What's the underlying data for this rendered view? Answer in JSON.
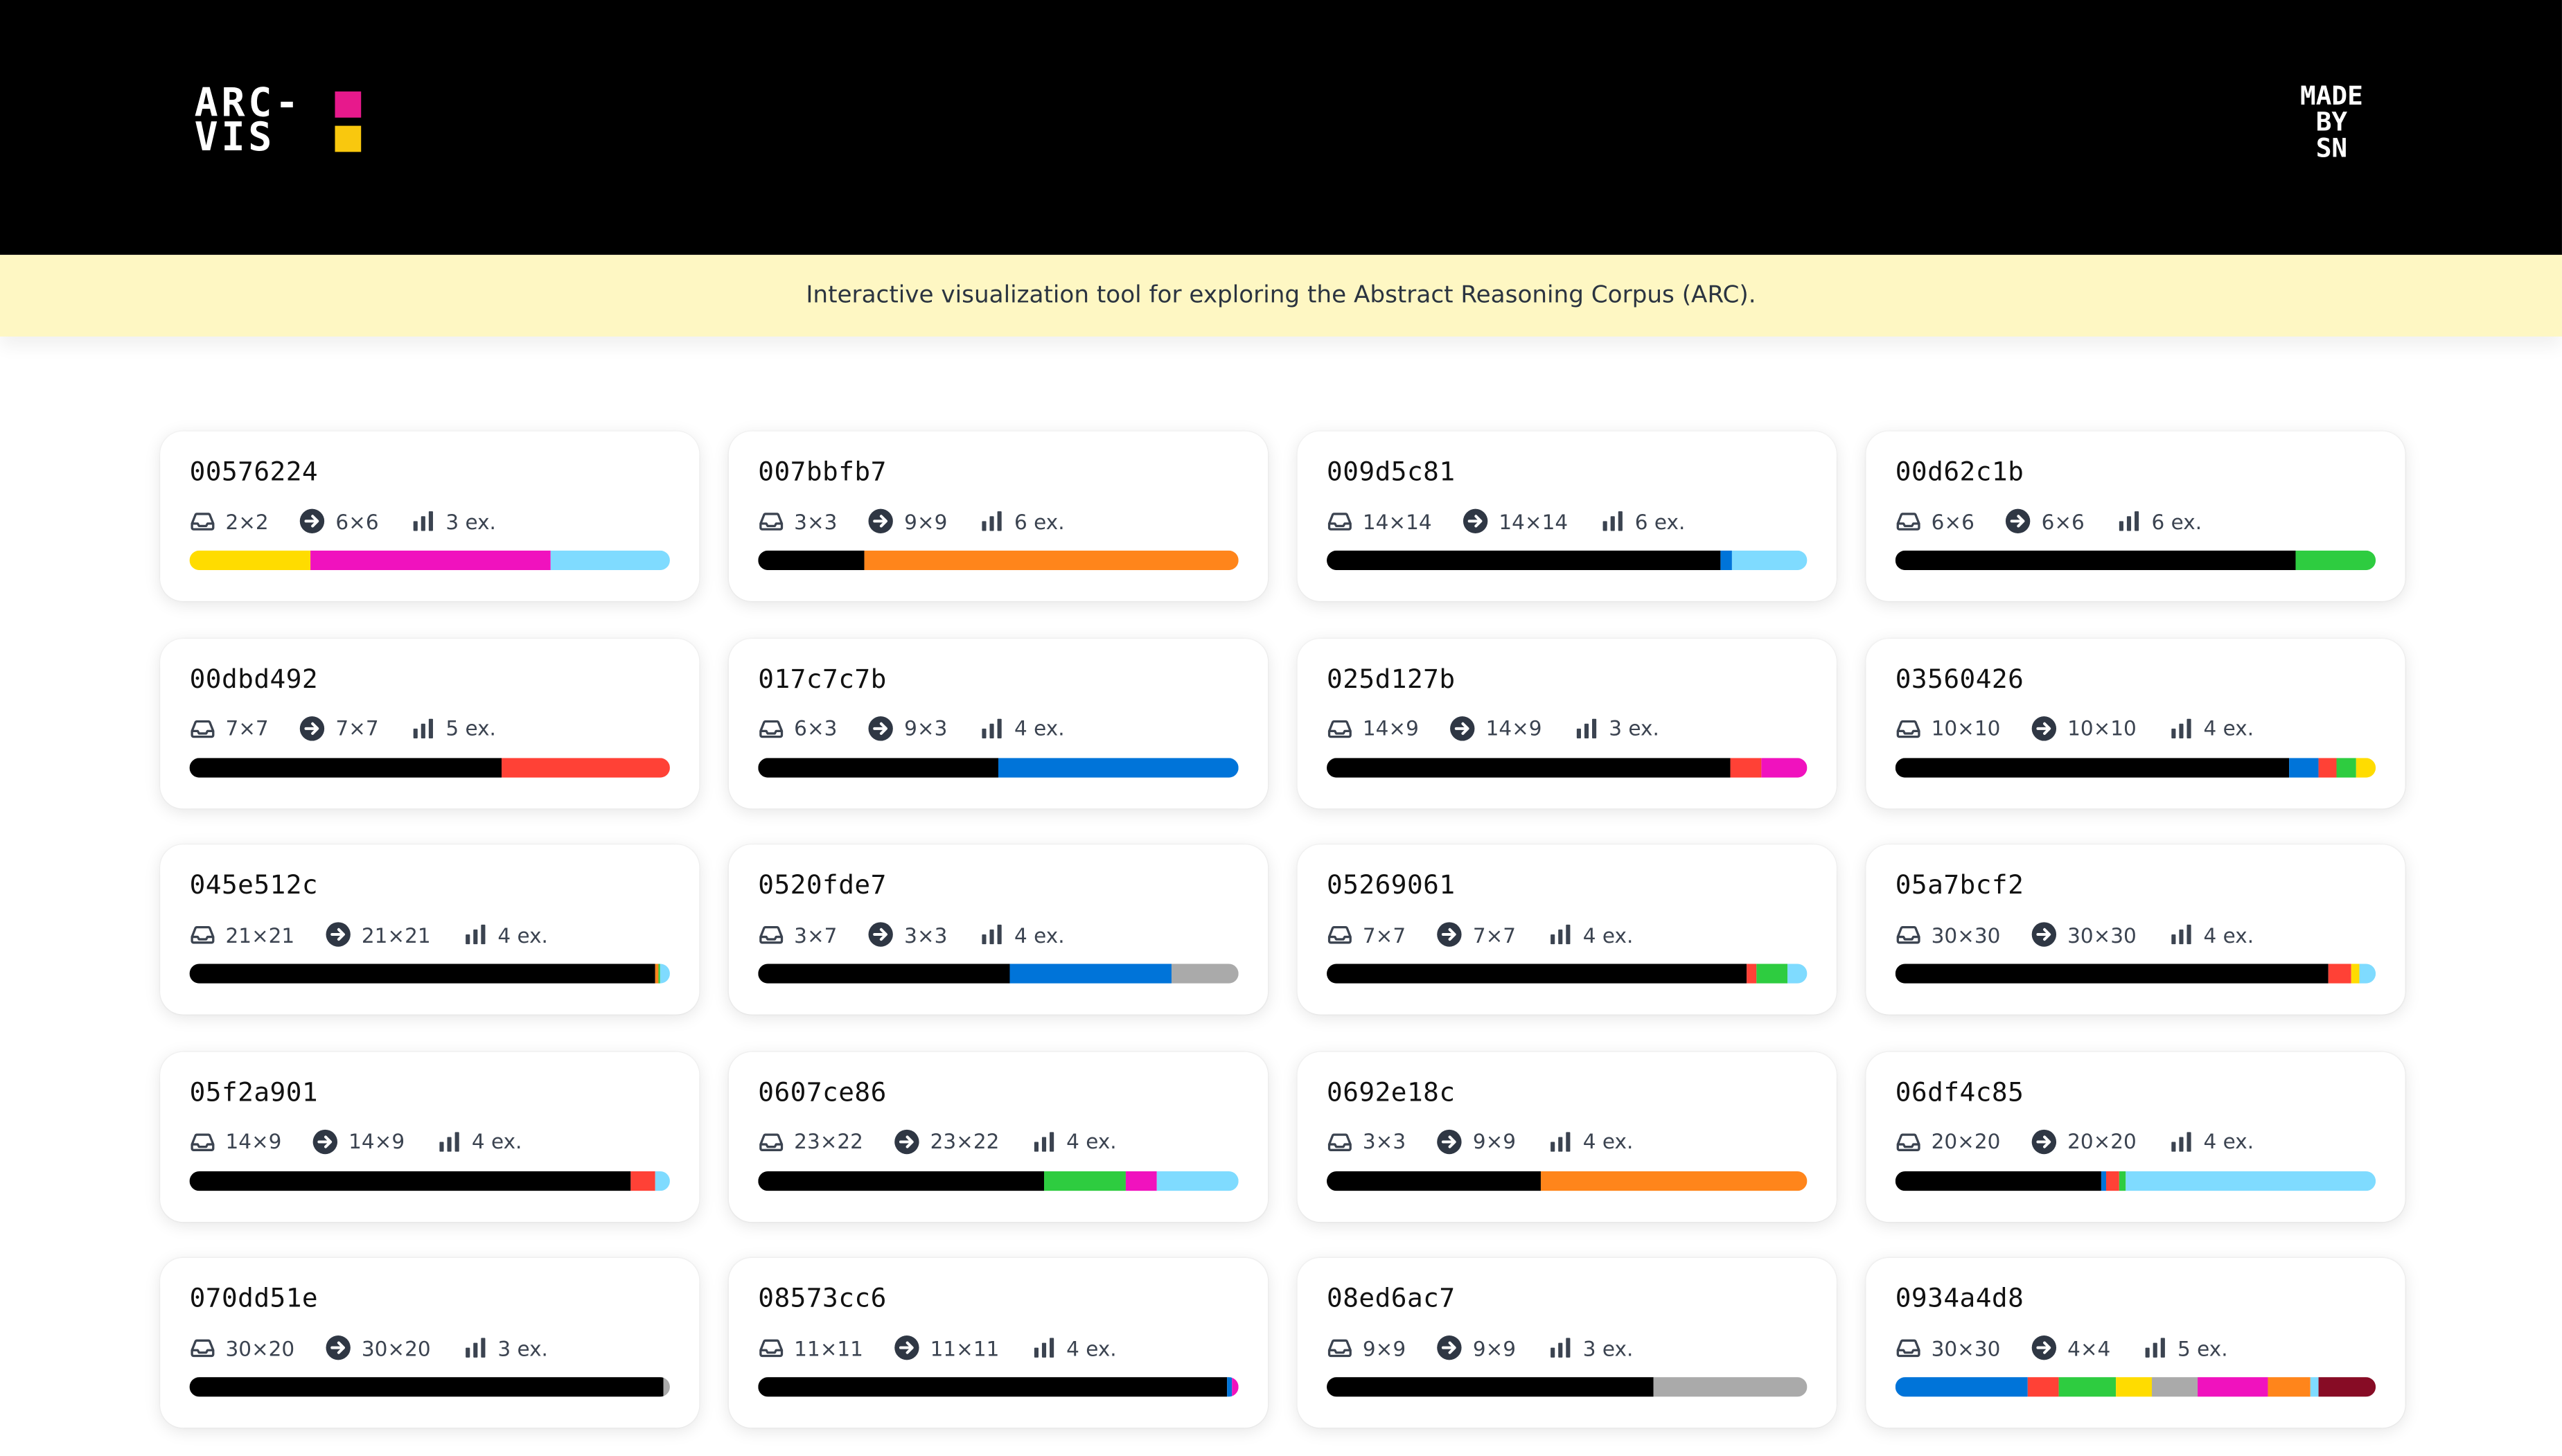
{
  "header": {
    "logo_line1": "ARC-",
    "logo_line2": "VIS",
    "logo_colors": [
      "#e7198c",
      "#f9c80e"
    ],
    "maker": [
      "MADE",
      "BY",
      "SN"
    ]
  },
  "banner": {
    "text": "Interactive visualization tool for exploring the Abstract Reasoning Corpus (ARC)."
  },
  "icons": {
    "input": "tray-icon",
    "output": "arrow-circle-right-icon",
    "examples": "bar-chart-icon"
  },
  "palette": {
    "black": "#000000",
    "blue": "#0074D9",
    "red": "#FF4136",
    "green": "#2ECC40",
    "yellow": "#FFDC00",
    "gray": "#AAAAAA",
    "magenta": "#F012BE",
    "orange": "#FF851B",
    "cyan": "#7FDBFF",
    "maroon": "#870C25"
  },
  "tasks": [
    {
      "id": "00576224",
      "input": "2×2",
      "output": "6×6",
      "examples": "3 ex.",
      "colors": [
        [
          "yellow",
          0.25
        ],
        [
          "magenta",
          0.5
        ],
        [
          "cyan",
          0.25
        ]
      ]
    },
    {
      "id": "007bbfb7",
      "input": "3×3",
      "output": "9×9",
      "examples": "6 ex.",
      "colors": [
        [
          "black",
          0.22
        ],
        [
          "orange",
          0.78
        ]
      ]
    },
    {
      "id": "009d5c81",
      "input": "14×14",
      "output": "14×14",
      "examples": "6 ex.",
      "colors": [
        [
          "black",
          0.82
        ],
        [
          "blue",
          0.025
        ],
        [
          "cyan",
          0.155
        ]
      ]
    },
    {
      "id": "00d62c1b",
      "input": "6×6",
      "output": "6×6",
      "examples": "6 ex.",
      "colors": [
        [
          "black",
          0.835
        ],
        [
          "green",
          0.165
        ]
      ]
    },
    {
      "id": "00dbd492",
      "input": "7×7",
      "output": "7×7",
      "examples": "5 ex.",
      "colors": [
        [
          "black",
          0.65
        ],
        [
          "red",
          0.35
        ]
      ]
    },
    {
      "id": "017c7c7b",
      "input": "6×3",
      "output": "9×3",
      "examples": "4 ex.",
      "colors": [
        [
          "black",
          0.5
        ],
        [
          "blue",
          0.5
        ]
      ]
    },
    {
      "id": "025d127b",
      "input": "14×9",
      "output": "14×9",
      "examples": "3 ex.",
      "colors": [
        [
          "black",
          0.84
        ],
        [
          "red",
          0.065
        ],
        [
          "magenta",
          0.095
        ]
      ]
    },
    {
      "id": "03560426",
      "input": "10×10",
      "output": "10×10",
      "examples": "4 ex.",
      "colors": [
        [
          "black",
          0.82
        ],
        [
          "blue",
          0.06
        ],
        [
          "red",
          0.04
        ],
        [
          "green",
          0.04
        ],
        [
          "yellow",
          0.04
        ]
      ]
    },
    {
      "id": "045e512c",
      "input": "21×21",
      "output": "21×21",
      "examples": "4 ex.",
      "colors": [
        [
          "black",
          0.97
        ],
        [
          "orange",
          0.005
        ],
        [
          "green",
          0.005
        ],
        [
          "cyan",
          0.02
        ]
      ]
    },
    {
      "id": "0520fde7",
      "input": "3×7",
      "output": "3×3",
      "examples": "4 ex.",
      "colors": [
        [
          "black",
          0.525
        ],
        [
          "blue",
          0.335
        ],
        [
          "gray",
          0.14
        ]
      ]
    },
    {
      "id": "05269061",
      "input": "7×7",
      "output": "7×7",
      "examples": "4 ex.",
      "colors": [
        [
          "black",
          0.875
        ],
        [
          "red",
          0.02
        ],
        [
          "green",
          0.065
        ],
        [
          "cyan",
          0.04
        ]
      ]
    },
    {
      "id": "05a7bcf2",
      "input": "30×30",
      "output": "30×30",
      "examples": "4 ex.",
      "colors": [
        [
          "black",
          0.9
        ],
        [
          "red",
          0.05
        ],
        [
          "yellow",
          0.015
        ],
        [
          "cyan",
          0.035
        ]
      ]
    },
    {
      "id": "05f2a901",
      "input": "14×9",
      "output": "14×9",
      "examples": "4 ex.",
      "colors": [
        [
          "black",
          0.92
        ],
        [
          "red",
          0.05
        ],
        [
          "cyan",
          0.03
        ]
      ]
    },
    {
      "id": "0607ce86",
      "input": "23×22",
      "output": "23×22",
      "examples": "4 ex.",
      "colors": [
        [
          "black",
          0.595
        ],
        [
          "green",
          0.17
        ],
        [
          "magenta",
          0.065
        ],
        [
          "cyan",
          0.17
        ]
      ]
    },
    {
      "id": "0692e18c",
      "input": "3×3",
      "output": "9×9",
      "examples": "4 ex.",
      "colors": [
        [
          "black",
          0.445
        ],
        [
          "orange",
          0.555
        ]
      ]
    },
    {
      "id": "06df4c85",
      "input": "20×20",
      "output": "20×20",
      "examples": "4 ex.",
      "colors": [
        [
          "black",
          0.43
        ],
        [
          "blue",
          0.01
        ],
        [
          "red",
          0.025
        ],
        [
          "green",
          0.015
        ],
        [
          "cyan",
          0.52
        ]
      ]
    },
    {
      "id": "070dd51e",
      "input": "30×20",
      "output": "30×20",
      "examples": "3 ex.",
      "colors": [
        [
          "black",
          0.985
        ],
        [
          "gray",
          0.015
        ]
      ]
    },
    {
      "id": "08573cc6",
      "input": "11×11",
      "output": "11×11",
      "examples": "4 ex.",
      "colors": [
        [
          "black",
          0.975
        ],
        [
          "blue",
          0.01
        ],
        [
          "magenta",
          0.015
        ]
      ]
    },
    {
      "id": "08ed6ac7",
      "input": "9×9",
      "output": "9×9",
      "examples": "3 ex.",
      "colors": [
        [
          "black",
          0.68
        ],
        [
          "gray",
          0.32
        ]
      ]
    },
    {
      "id": "0934a4d8",
      "input": "30×30",
      "output": "4×4",
      "examples": "5 ex.",
      "colors": [
        [
          "blue",
          0.275
        ],
        [
          "red",
          0.065
        ],
        [
          "green",
          0.12
        ],
        [
          "yellow",
          0.075
        ],
        [
          "gray",
          0.095
        ],
        [
          "magenta",
          0.145
        ],
        [
          "orange",
          0.09
        ],
        [
          "cyan",
          0.015
        ],
        [
          "maroon",
          0.12
        ]
      ]
    }
  ]
}
